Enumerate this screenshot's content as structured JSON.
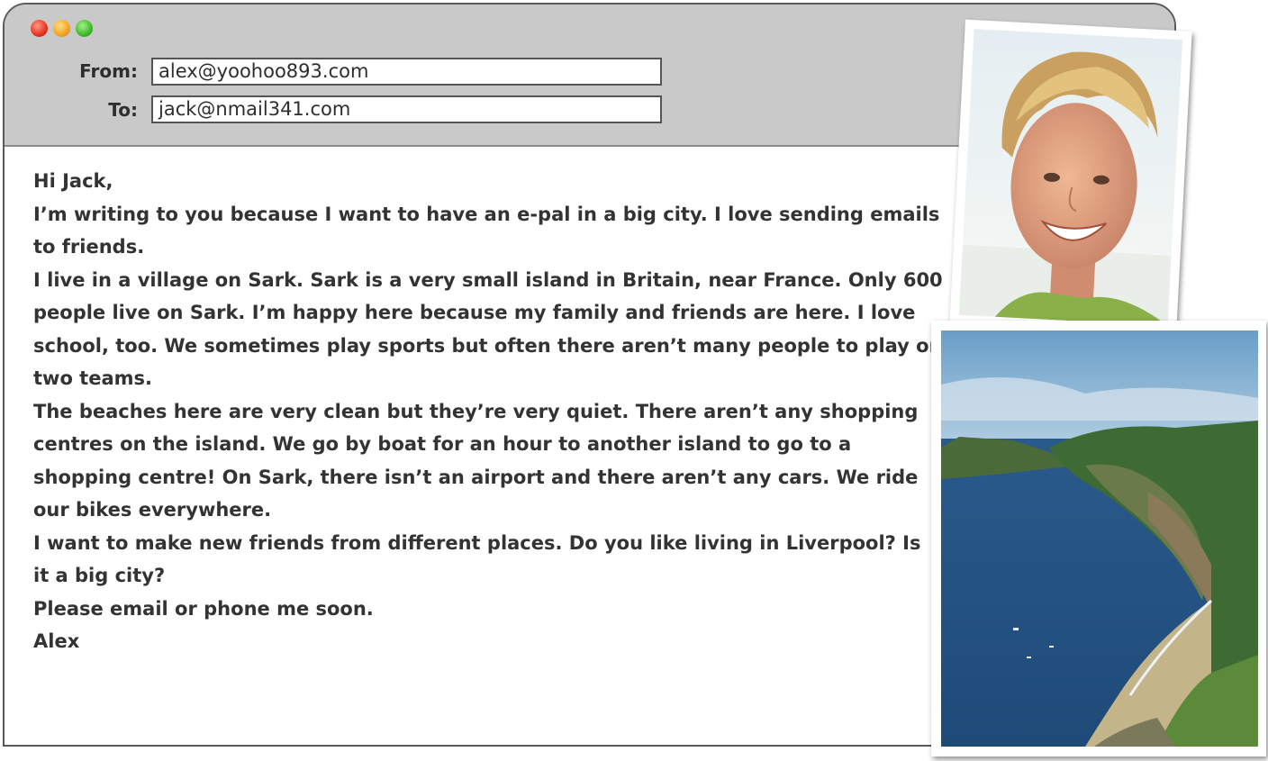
{
  "email": {
    "from_label": "From:",
    "from_value": "alex@yoohoo893.com",
    "to_label": "To:",
    "to_value": "jack@nmail341.com",
    "body_paragraphs": [
      "Hi Jack,",
      "I’m writing to you because I want to have an e-pal in a big city. I love sending emails to friends.",
      "I live in a village on Sark. Sark is a very small island in Britain, near France. Only 600 people live on Sark. I’m happy here because my family and friends are here. I love school, too. We sometimes play sports but often there aren’t many people to play on two teams.",
      "The beaches here are very clean but they’re very quiet. There aren’t any shopping centres on the island. We go by boat for an hour to another island to go to a shopping centre! On Sark, there isn’t an airport and there aren’t any cars. We ride our bikes everywhere.",
      "I want to make new friends from different places. Do you like living in Liverpool? Is it a big city?",
      "Please email or phone me soon.",
      "Alex"
    ]
  },
  "window_controls": {
    "close_color": "#e8321c",
    "minimize_color": "#f5a21a",
    "maximize_color": "#3cba2a"
  },
  "photos": {
    "boy": "portrait-photo",
    "island": "coastline-photo"
  }
}
